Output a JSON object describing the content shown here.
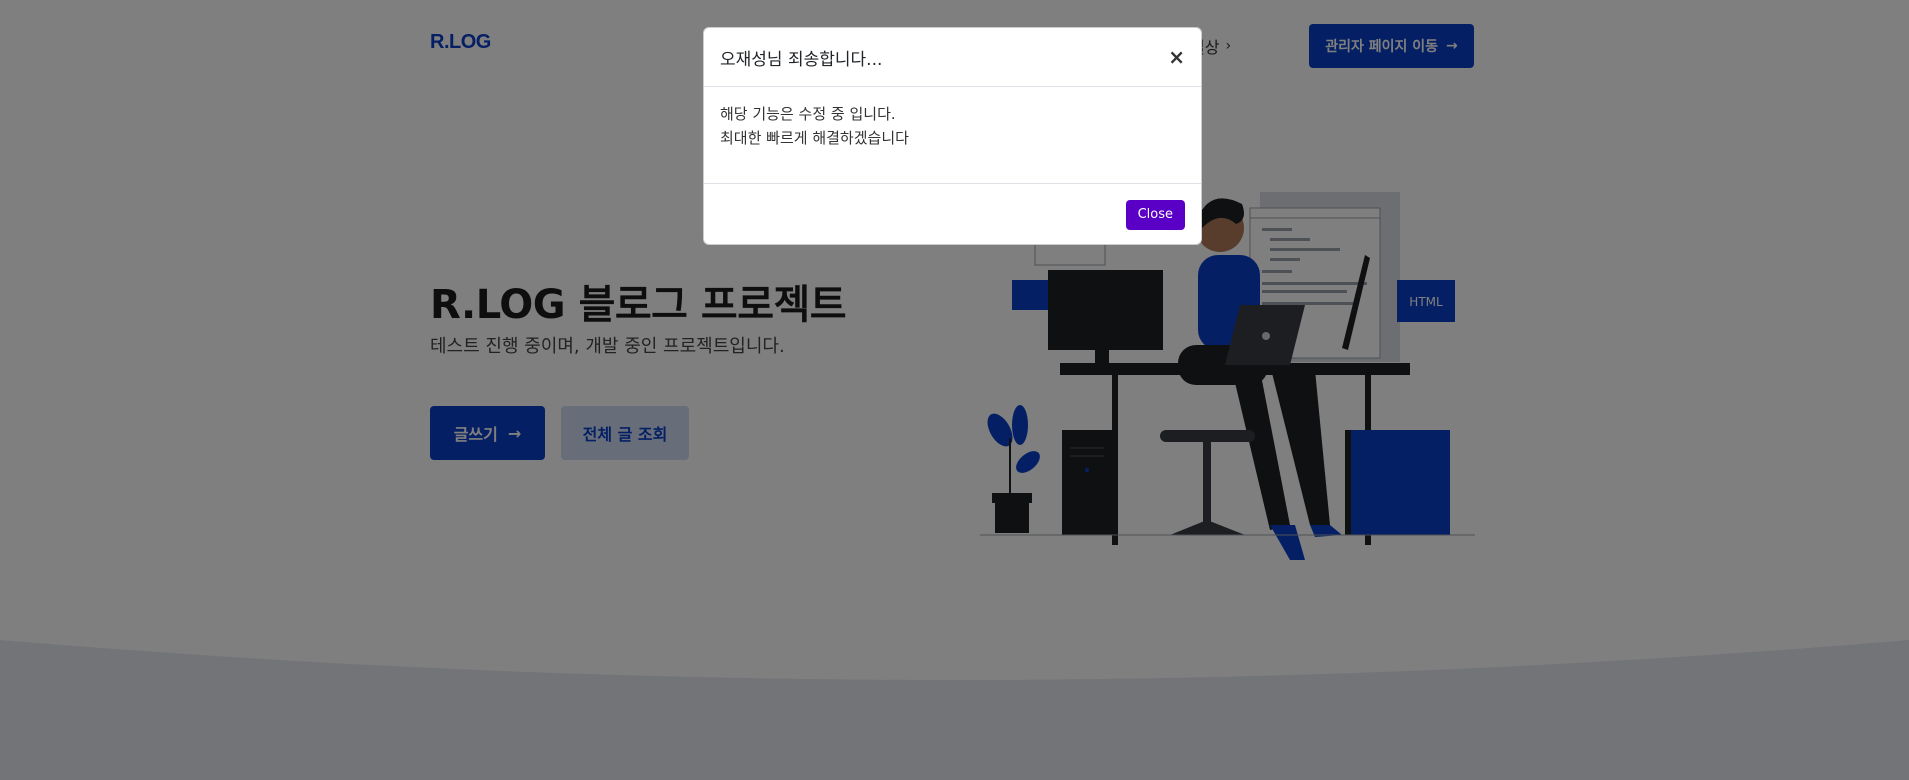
{
  "header": {
    "logo": "R.LOG",
    "nav": [
      {
        "label": "일상",
        "icon": "chevron-right-icon"
      }
    ],
    "admin_button": "관리자 페이지 이동"
  },
  "hero": {
    "title": "R.LOG 블로그 프로젝트",
    "subtitle": "테스트 진행 중이며, 개발 중인 프로젝트입니다.",
    "write_button": "글쓰기",
    "all_posts_button": "전체 글 조회"
  },
  "illustration": {
    "html_tag": "HTML"
  },
  "modal": {
    "title": "오재성님 죄송합니다...",
    "close_icon": "×",
    "body_lines": [
      "해당 기능은 수정 중 입니다.",
      "최대한 빠르게 해결하겠습니다"
    ],
    "close_button": "Close"
  },
  "colors": {
    "brand": "#0a3fc8",
    "modal_button": "#5a00c6",
    "light_button": "#cfdcf3"
  }
}
